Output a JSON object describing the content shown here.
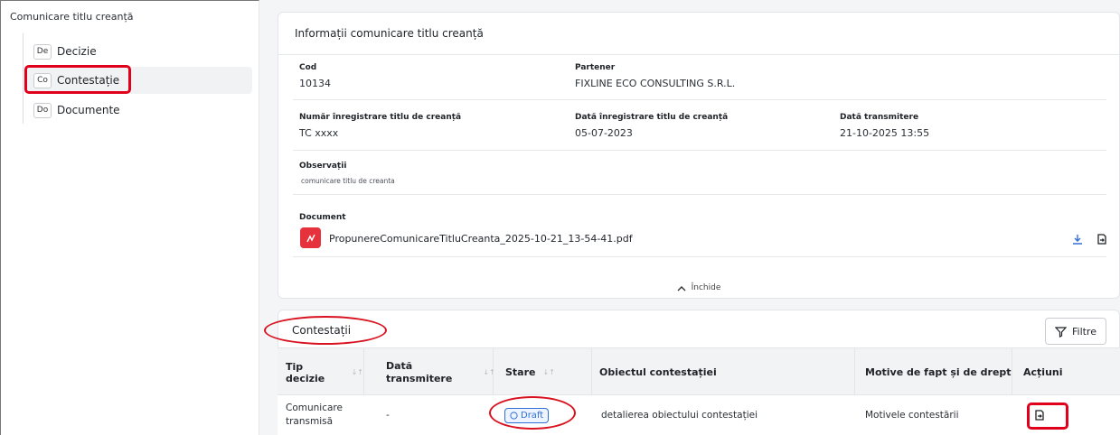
{
  "sidebar": {
    "title": "Comunicare titlu creanță",
    "items": [
      {
        "badge": "De",
        "label": "Decizie"
      },
      {
        "badge": "Co",
        "label": "Contestație"
      },
      {
        "badge": "Do",
        "label": "Documente"
      }
    ]
  },
  "info": {
    "header": "Informații comunicare titlu creanță",
    "cod_label": "Cod",
    "cod_value": "10134",
    "partener_label": "Partener",
    "partener_value": "FIXLINE ECO CONSULTING S.R.L.",
    "nr_label": "Număr înregistrare titlu de creanță",
    "nr_value": "TC xxxx",
    "data_inreg_label": "Dată înregistrare titlu de creanță",
    "data_inreg_value": "05-07-2023",
    "data_trans_label": "Dată transmitere",
    "data_trans_value": "21-10-2025 13:55",
    "obs_label": "Observații",
    "obs_value": "comunicare titlu de creanta",
    "doc_label": "Document",
    "doc_name": "PropunereComunicareTitluCreanta_2025-10-21_13-54-41.pdf",
    "close_label": "Închide"
  },
  "contestatii": {
    "title": "Contestații",
    "filters_label": "Filtre",
    "columns": {
      "tip": "Tip decizie",
      "data_line1": "Dată",
      "data_line2": "transmitere",
      "stare": "Stare",
      "obiect": "Obiectul contestației",
      "motive": "Motive de fapt și de drept",
      "actiuni": "Acțiuni"
    },
    "row": {
      "tip_line1": "Comunicare",
      "tip_line2": "transmisă",
      "data": "-",
      "stare": "Draft",
      "obiect": "detalierea obiectului contestației",
      "motive": "Motivele contestării"
    }
  }
}
